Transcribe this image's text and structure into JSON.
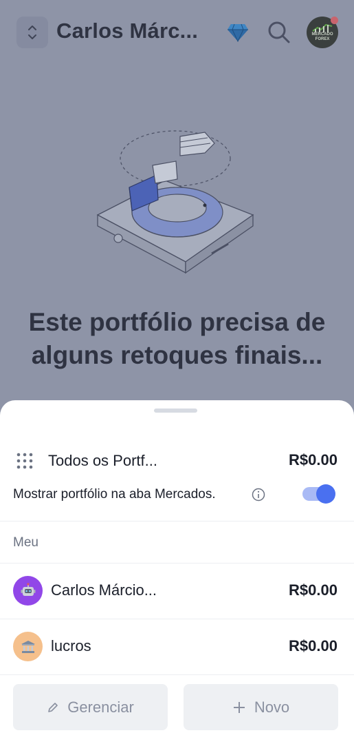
{
  "header": {
    "title": "Carlos Márc...",
    "switch_icon": "chevron-up-down-icon",
    "premium_icon": "diamond-icon",
    "search_icon": "search-icon",
    "avatar_text_line1": "MERCADO",
    "avatar_text_line2": "FOREX"
  },
  "empty_state": {
    "heading": "Este portfólio precisa de alguns retoques finais..."
  },
  "sheet": {
    "all_portfolios": {
      "label": "Todos os Portf...",
      "amount": "R$0.00",
      "icon": "grid-dots-icon"
    },
    "show_in_markets": {
      "label": "Mostrar portfólio na aba Mercados.",
      "enabled": true
    },
    "section_title": "Meu",
    "portfolios": [
      {
        "name": "Carlos Márcio...",
        "amount": "R$0.00",
        "icon": "robot-icon",
        "color": "#9147e8"
      },
      {
        "name": "lucros",
        "amount": "R$0.00",
        "icon": "bank-icon",
        "color": "#f5c08c"
      }
    ],
    "manage_button": "Gerenciar",
    "new_button": "Novo"
  },
  "colors": {
    "overlay": "#8e94a7",
    "accent": "#4a70f0",
    "toggle_track": "#a9baf5"
  }
}
